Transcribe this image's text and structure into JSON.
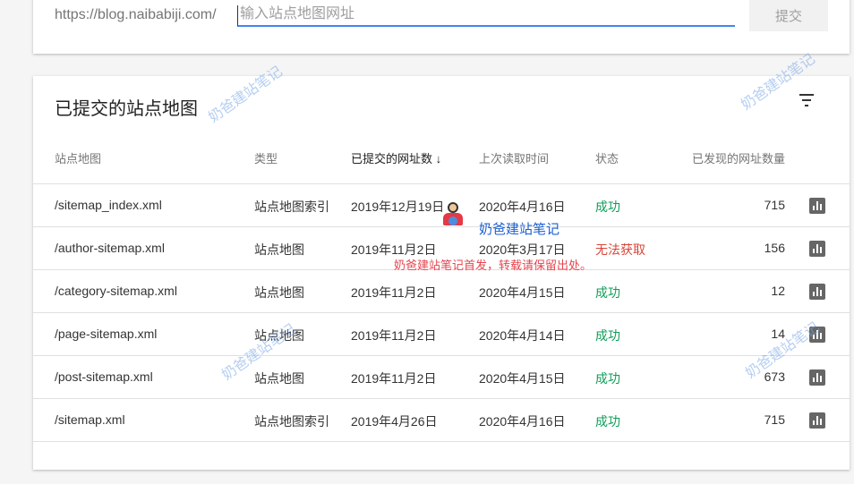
{
  "submit_form": {
    "prefix": "https://blog.naibabiji.com/",
    "placeholder": "输入站点地图网址",
    "submit_label": "提交"
  },
  "sitemaps_card": {
    "title": "已提交的站点地图",
    "headers": [
      "站点地图",
      "类型",
      "已提交的网址数 ↓",
      "上次读取时间",
      "状态",
      "已发现的网址数量"
    ],
    "rows": [
      {
        "sitemap": "/sitemap_index.xml",
        "type": "站点地图索引",
        "submitted": "2019年12月19日",
        "last_read": "2020年4月16日",
        "status": "成功",
        "discovered": "715"
      },
      {
        "sitemap": "/author-sitemap.xml",
        "type": "站点地图",
        "submitted": "2019年11月2日",
        "last_read": "2020年3月17日",
        "status": "无法获取",
        "discovered": "156"
      },
      {
        "sitemap": "/category-sitemap.xml",
        "type": "站点地图",
        "submitted": "2019年11月2日",
        "last_read": "2020年4月15日",
        "status": "成功",
        "discovered": "12"
      },
      {
        "sitemap": "/page-sitemap.xml",
        "type": "站点地图",
        "submitted": "2019年11月2日",
        "last_read": "2020年4月14日",
        "status": "成功",
        "discovered": "14"
      },
      {
        "sitemap": "/post-sitemap.xml",
        "type": "站点地图",
        "submitted": "2019年11月2日",
        "last_read": "2020年4月15日",
        "status": "成功",
        "discovered": "673"
      },
      {
        "sitemap": "/sitemap.xml",
        "type": "站点地图索引",
        "submitted": "2019年4月26日",
        "last_read": "2020年4月16日",
        "status": "成功",
        "discovered": "715"
      }
    ]
  },
  "watermark": {
    "text": "奶爸建站笔记",
    "notice": "奶爸建站笔记首发，转载请保留出处。"
  },
  "colors": {
    "success": "#0f9d58",
    "error": "#db4437",
    "accent": "#4285f4"
  }
}
